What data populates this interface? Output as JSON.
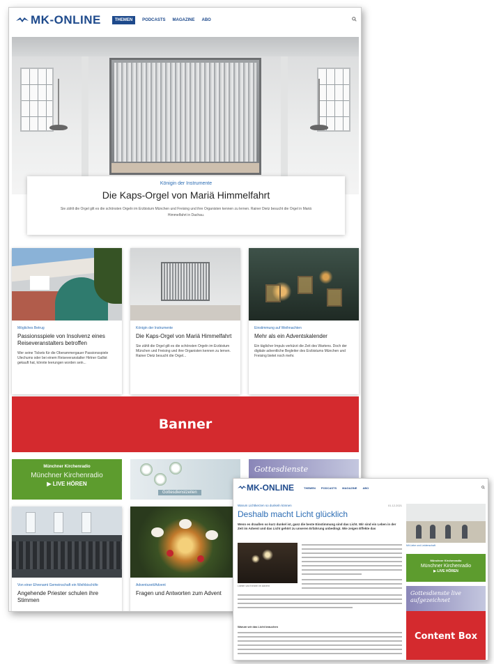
{
  "main_page": {
    "logo": "MK-ONLINE",
    "nav": [
      "THEMEN",
      "PODCASTS",
      "MAGAZINE",
      "ABO"
    ],
    "hero": {
      "kicker": "Königin der Instrumente",
      "title": "Die Kaps-Orgel von Mariä Himmelfahrt",
      "description": "Sie zählt die Orgel gilt es die schönsten Orgeln im Erzbistum München und Freising und ihre Organisten kennen zu lernen. Rainer Dietz besucht die Orgel in Mariä Himmelfahrt in Dachau."
    },
    "teasers": [
      {
        "kicker": "Mögliches Betrug",
        "title": "Passionsspiele von Insolvenz eines Reiseveranstalters betroffen",
        "text": "Wer seine Tickets für die Oberammergauer Passionsspiele Ulechums oder bei einem Reiseveranstalter Hirtner Gallist gekauft hat, könnte leerungen worden sein..."
      },
      {
        "kicker": "Königin der Instrumente",
        "title": "Die Kaps-Orgel von Mariä Himmelfahrt",
        "text": "Sie zählt die Orgel gilt es die schönsten Orgeln im Erzbistum München und Freising und ihre Organisten kennen zu lernen. Rainer Dietz besucht die Orgel..."
      },
      {
        "kicker": "Einstimmung auf Weihnachten",
        "title": "Mehr als ein Adventskalender",
        "text": "Ein täglicher Impuls verkürzt die Zeit des Wartens. Doch der digitale adventliche Begleiter des Erzbistums München und Freising bietet noch mehr."
      }
    ],
    "banner_label": "Banner",
    "promos": {
      "radio_small": "Münchner Kirchenradio",
      "radio_big": "Münchner Kirchenradio",
      "radio_live": "LIVE HÖREN",
      "flowers_caption": "Gottesdienstzeiten",
      "gottes_script": "Gottesdienste"
    },
    "bottom_cards": [
      {
        "kicker": "Von einer Ehrenamt Gemeinschaft ein Weihbischöfe",
        "title": "Angehende Priester schulen ihre Stimmen"
      },
      {
        "kicker": "Adventszeit/Advent",
        "title": "Fragen und Antworten zum Advent"
      }
    ]
  },
  "second_page": {
    "logo": "MK-ONLINE",
    "nav": [
      "THEMEN",
      "PODCASTS",
      "MAGAZINE",
      "ABO"
    ],
    "article": {
      "kicker": "Warum Lichtkerzen so dunkeln können",
      "meta": "01.12.2021",
      "title": "Deshalb macht Licht glücklich",
      "lead": "Wenn es draußen so kurz dunkel ist, ganz die beste Einstimmung sind das Licht. Wir sind ein Leben in der Zeit im Advent und das Licht gehört zu unseren Erfahrung unbedingt. Wie zeigen Effekte das",
      "caption": "Lichter und Kerzen im Advent",
      "subhead": "Warum wir das Licht brauchen"
    },
    "sidebar": {
      "photo_caption": "Mit Liebe und Leidenschaft",
      "radio_small": "Münchner Kirchenradio",
      "radio_big": "Münchner Kirchenradio",
      "radio_live": "LIVE HÖREN",
      "gottes_script": "Gottesdienste live aufgezeichnet"
    },
    "content_box_label": "Content Box"
  }
}
